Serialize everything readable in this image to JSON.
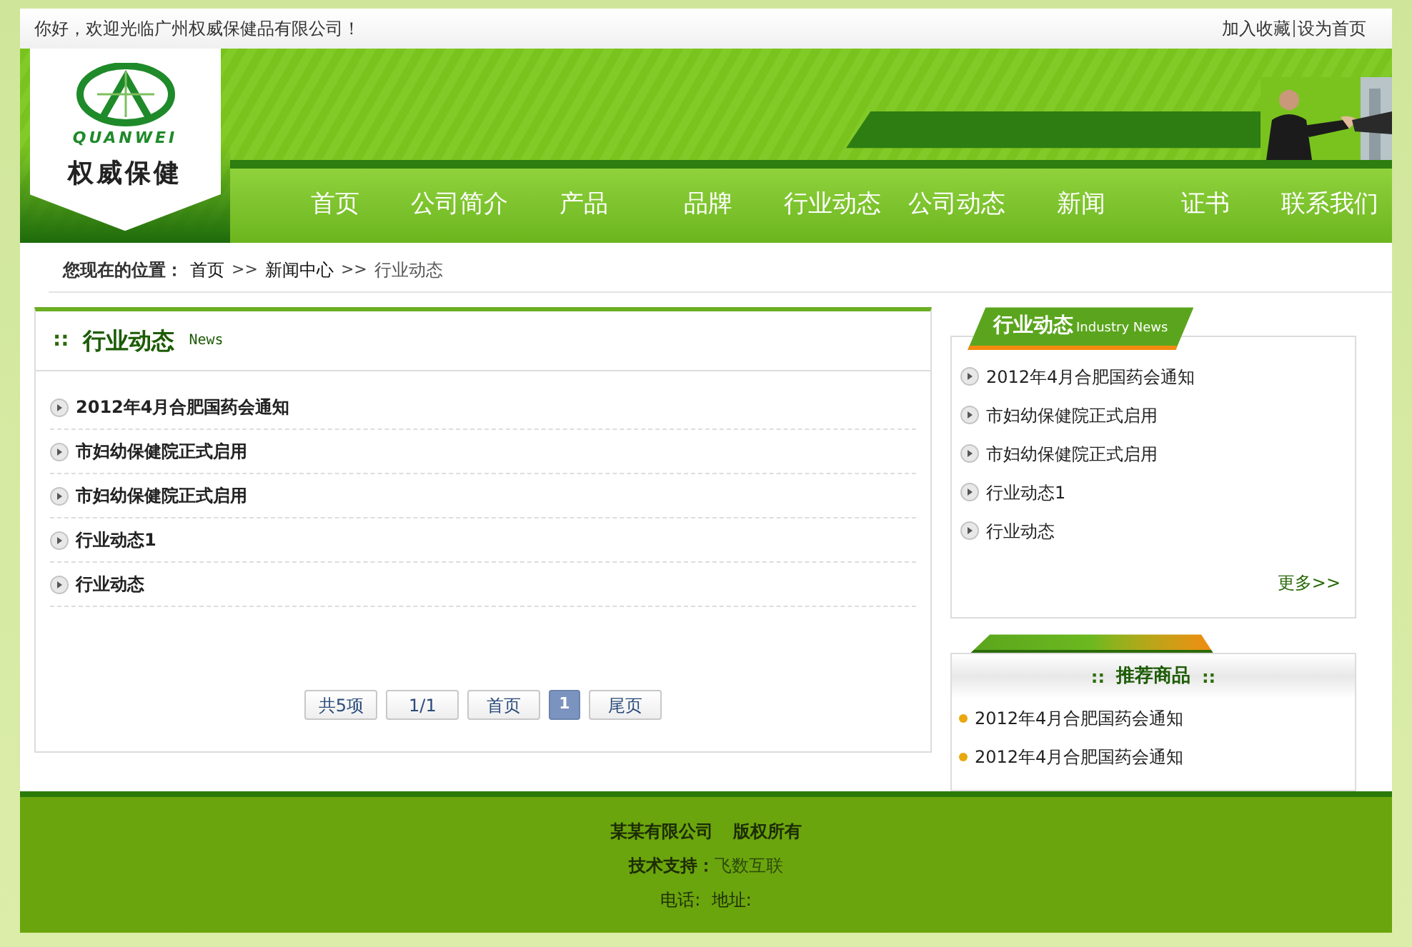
{
  "top_bar": {
    "greeting": "你好，欢迎光临广州权威保健品有限公司！",
    "links": [
      "加入收藏",
      "设为首页"
    ]
  },
  "logo": {
    "latin": "QUANWEI",
    "name": "权威保健"
  },
  "nav": [
    "首页",
    "公司简介",
    "产品",
    "品牌",
    "行业动态",
    "公司动态",
    "新闻",
    "证书",
    "联系我们"
  ],
  "breadcrumb": {
    "label": "您现在的位置：",
    "crumbs": [
      {
        "kind": "link",
        "text": "首页"
      },
      {
        "kind": "sep",
        "text": ">>"
      },
      {
        "kind": "link",
        "text": "新闻中心"
      },
      {
        "kind": "sep",
        "text": ">>"
      },
      {
        "kind": "current",
        "text": "行业动态"
      }
    ]
  },
  "main": {
    "mark": "::",
    "title": "行业动态",
    "subtitle": "News",
    "items": [
      "2012年4月合肥国药会通知",
      "市妇幼保健院正式启用",
      "市妇幼保健院正式启用",
      "行业动态1",
      "行业动态"
    ],
    "pagination": [
      {
        "label": "共5项",
        "selected": false
      },
      {
        "label": "1/1",
        "selected": false
      },
      {
        "label": "首页",
        "selected": false
      },
      {
        "label": "1",
        "selected": true
      },
      {
        "label": "尾页",
        "selected": false
      }
    ]
  },
  "sidebar": {
    "news": {
      "title": "行业动态",
      "subtitle": "Industry News",
      "items": [
        "2012年4月合肥国药会通知",
        "市妇幼保健院正式启用",
        "市妇幼保健院正式启用",
        "行业动态1",
        "行业动态"
      ],
      "more": "更多>>"
    },
    "products": {
      "mark_left": "::",
      "title": "推荐商品",
      "mark_right": "::",
      "items": [
        "2012年4月合肥国药会通知",
        "2012年4月合肥国药会通知"
      ]
    }
  },
  "footer": {
    "company": "某某有限公司",
    "rights": "版权所有",
    "support_label": "技术支持：",
    "support": "飞数互联",
    "contact": "电话:  地址:"
  }
}
